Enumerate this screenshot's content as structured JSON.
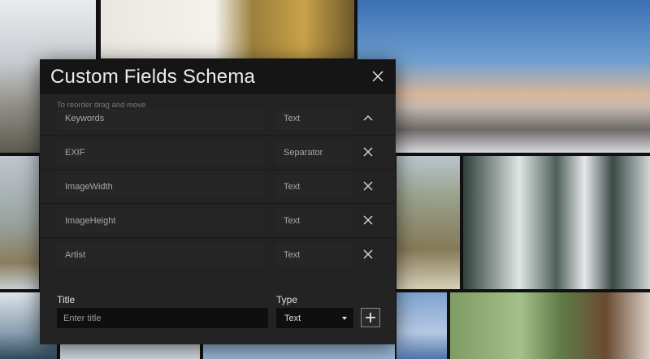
{
  "dialog": {
    "title": "Custom Fields Schema",
    "hint": "To reorder drag and move"
  },
  "fields": [
    {
      "name": "Keywords",
      "type": "Text",
      "action": "chevron-up-icon"
    },
    {
      "name": "EXIF",
      "type": "Separator",
      "action": "close-icon"
    },
    {
      "name": "ImageWidth",
      "type": "Text",
      "action": "close-icon"
    },
    {
      "name": "ImageHeight",
      "type": "Text",
      "action": "close-icon"
    },
    {
      "name": "Artist",
      "type": "Text",
      "action": "close-icon"
    }
  ],
  "new_field": {
    "title_label": "Title",
    "title_placeholder": "Enter title",
    "type_label": "Type",
    "type_value": "Text"
  },
  "colors": {
    "dialog_bg": "#232323",
    "header_bg": "#151515",
    "cell_bg": "#262626",
    "input_bg": "#0f0f0f"
  }
}
